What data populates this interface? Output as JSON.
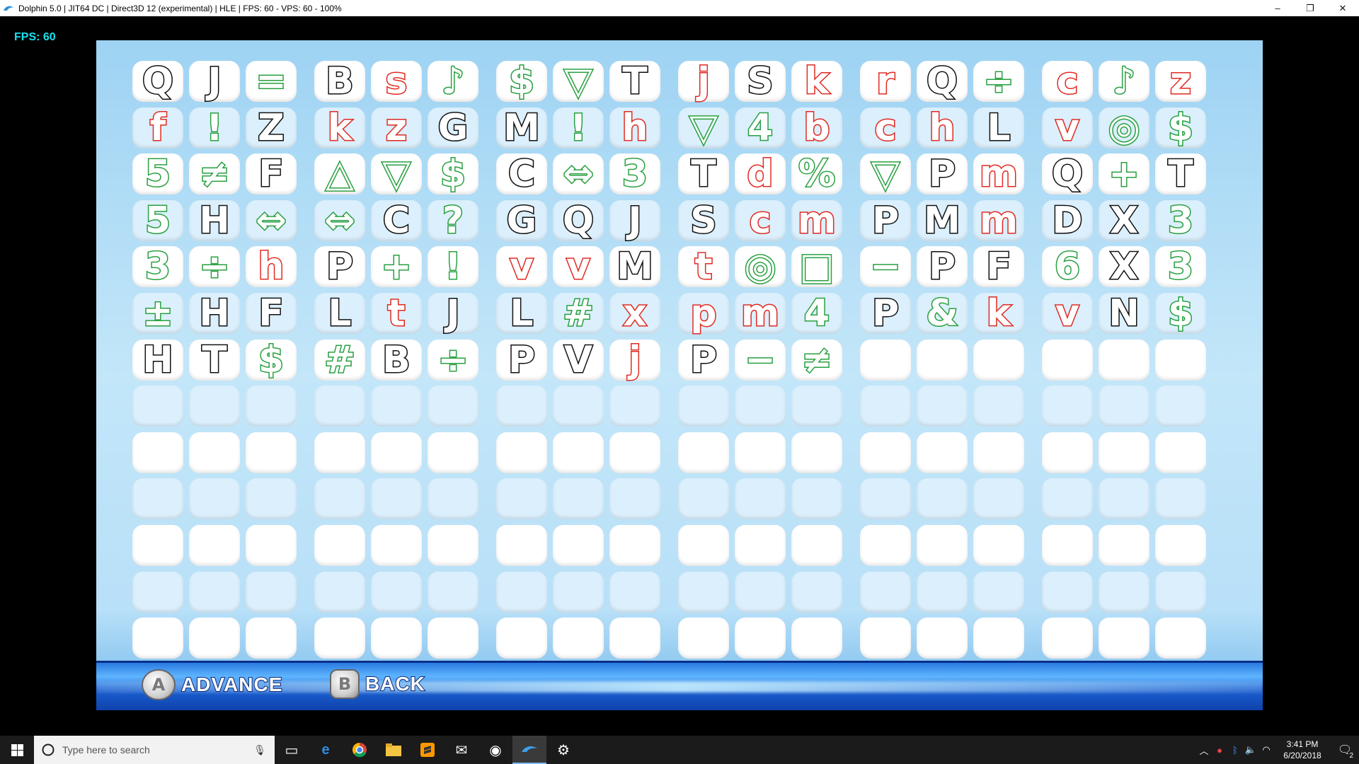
{
  "window": {
    "title": "Dolphin 5.0 | JIT64 DC | Direct3D 12 (experimental) | HLE | FPS: 60 - VPS: 60 - 100%",
    "minimize": "–",
    "restore": "❐",
    "close": "✕"
  },
  "overlay": {
    "fps": "FPS: 60"
  },
  "grid": {
    "rows": [
      [
        [
          "Q",
          "k"
        ],
        [
          "J",
          "k"
        ],
        [
          "=",
          "g"
        ],
        [
          "B",
          "k"
        ],
        [
          "s",
          "r"
        ],
        [
          "♪",
          "g"
        ],
        [
          "$",
          "g"
        ],
        [
          "▽",
          "g"
        ],
        [
          "T",
          "k"
        ],
        [
          "j",
          "r"
        ],
        [
          "S",
          "k"
        ],
        [
          "k",
          "r"
        ],
        [
          "r",
          "r"
        ],
        [
          "Q",
          "k"
        ],
        [
          "÷",
          "g"
        ],
        [
          "c",
          "r"
        ],
        [
          "♪",
          "g"
        ],
        [
          "z",
          "r"
        ]
      ],
      [
        [
          "f",
          "r"
        ],
        [
          "!",
          "g"
        ],
        [
          "Z",
          "k"
        ],
        [
          "k",
          "r"
        ],
        [
          "z",
          "r"
        ],
        [
          "G",
          "k"
        ],
        [
          "M",
          "k"
        ],
        [
          "!",
          "g"
        ],
        [
          "h",
          "r"
        ],
        [
          "▽",
          "g"
        ],
        [
          "4",
          "g"
        ],
        [
          "b",
          "r"
        ],
        [
          "c",
          "r"
        ],
        [
          "h",
          "r"
        ],
        [
          "L",
          "k"
        ],
        [
          "v",
          "r"
        ],
        [
          "◎",
          "g"
        ],
        [
          "$",
          "g"
        ]
      ],
      [
        [
          "5",
          "g"
        ],
        [
          "≠",
          "g"
        ],
        [
          "F",
          "k"
        ],
        [
          "△",
          "g"
        ],
        [
          "▽",
          "g"
        ],
        [
          "$",
          "g"
        ],
        [
          "C",
          "k"
        ],
        [
          "⇔",
          "g"
        ],
        [
          "3",
          "g"
        ],
        [
          "T",
          "k"
        ],
        [
          "d",
          "r"
        ],
        [
          "%",
          "g"
        ],
        [
          "▽",
          "g"
        ],
        [
          "P",
          "k"
        ],
        [
          "m",
          "r"
        ],
        [
          "Q",
          "k"
        ],
        [
          "+",
          "g"
        ],
        [
          "T",
          "k"
        ]
      ],
      [
        [
          "5",
          "g"
        ],
        [
          "H",
          "k"
        ],
        [
          "⇔",
          "g"
        ],
        [
          "⇔",
          "g"
        ],
        [
          "C",
          "k"
        ],
        [
          "?",
          "g"
        ],
        [
          "G",
          "k"
        ],
        [
          "Q",
          "k"
        ],
        [
          "J",
          "k"
        ],
        [
          "S",
          "k"
        ],
        [
          "c",
          "r"
        ],
        [
          "m",
          "r"
        ],
        [
          "P",
          "k"
        ],
        [
          "M",
          "k"
        ],
        [
          "m",
          "r"
        ],
        [
          "D",
          "k"
        ],
        [
          "X",
          "k"
        ],
        [
          "3",
          "g"
        ]
      ],
      [
        [
          "3",
          "g"
        ],
        [
          "÷",
          "g"
        ],
        [
          "h",
          "r"
        ],
        [
          "P",
          "k"
        ],
        [
          "+",
          "g"
        ],
        [
          "!",
          "g"
        ],
        [
          "v",
          "r"
        ],
        [
          "v",
          "r"
        ],
        [
          "M",
          "k"
        ],
        [
          "t",
          "r"
        ],
        [
          "◎",
          "g"
        ],
        [
          "□",
          "g"
        ],
        [
          "−",
          "g"
        ],
        [
          "P",
          "k"
        ],
        [
          "F",
          "k"
        ],
        [
          "6",
          "g"
        ],
        [
          "X",
          "k"
        ],
        [
          "3",
          "g"
        ]
      ],
      [
        [
          "±",
          "g"
        ],
        [
          "H",
          "k"
        ],
        [
          "F",
          "k"
        ],
        [
          "L",
          "k"
        ],
        [
          "t",
          "r"
        ],
        [
          "J",
          "k"
        ],
        [
          "L",
          "k"
        ],
        [
          "#",
          "g"
        ],
        [
          "x",
          "r"
        ],
        [
          "p",
          "r"
        ],
        [
          "m",
          "r"
        ],
        [
          "4",
          "g"
        ],
        [
          "P",
          "k"
        ],
        [
          "&",
          "g"
        ],
        [
          "k",
          "r"
        ],
        [
          "v",
          "r"
        ],
        [
          "N",
          "k"
        ],
        [
          "$",
          "g"
        ]
      ],
      [
        [
          "H",
          "k"
        ],
        [
          "T",
          "k"
        ],
        [
          "$",
          "g"
        ],
        [
          "#",
          "g"
        ],
        [
          "B",
          "k"
        ],
        [
          "÷",
          "g"
        ],
        [
          "P",
          "k"
        ],
        [
          "V",
          "k"
        ],
        [
          "j",
          "r"
        ],
        [
          "P",
          "k"
        ],
        [
          "−",
          "g"
        ],
        [
          "≠",
          "g"
        ],
        [
          "",
          ""
        ],
        [
          "",
          ""
        ],
        [
          "",
          ""
        ],
        [
          "",
          ""
        ],
        [
          "",
          ""
        ],
        [
          "",
          ""
        ]
      ]
    ],
    "total_rows": 13,
    "colors": {
      "k": "#111111",
      "r": "#e02a22",
      "g": "#28a040"
    }
  },
  "controls": {
    "advance_key": "A",
    "advance_label": "ADVANCE",
    "back_key": "B",
    "back_label": "BACK"
  },
  "taskbar": {
    "search_placeholder": "Type here to search",
    "time": "3:41 PM",
    "date": "6/20/2018",
    "notification_count": "2"
  }
}
